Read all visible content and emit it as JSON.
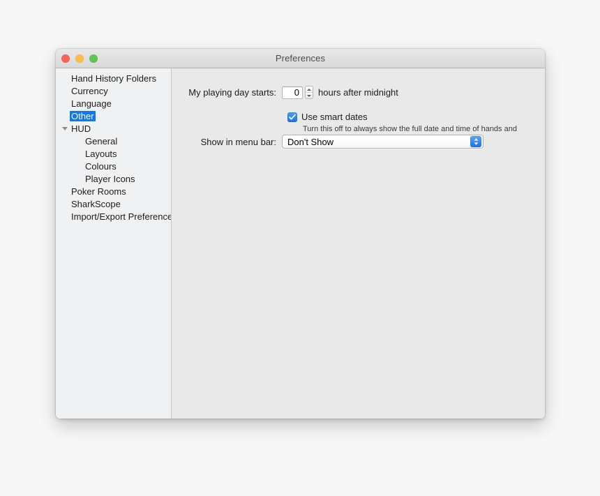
{
  "window": {
    "title": "Preferences",
    "traffic_lights": [
      {
        "name": "close",
        "color": "#f4645a"
      },
      {
        "name": "minimize",
        "color": "#f9bd4e"
      },
      {
        "name": "zoom",
        "color": "#61c555"
      }
    ]
  },
  "sidebar": {
    "selected": "Other",
    "items": [
      {
        "label": "Hand History Folders",
        "level": 0,
        "selected": false,
        "disclosure": false
      },
      {
        "label": "Currency",
        "level": 0,
        "selected": false,
        "disclosure": false
      },
      {
        "label": "Language",
        "level": 0,
        "selected": false,
        "disclosure": false
      },
      {
        "label": "Other",
        "level": 0,
        "selected": true,
        "disclosure": false
      },
      {
        "label": "HUD",
        "level": 0,
        "selected": false,
        "disclosure": true
      },
      {
        "label": "General",
        "level": 1,
        "selected": false,
        "disclosure": false
      },
      {
        "label": "Layouts",
        "level": 1,
        "selected": false,
        "disclosure": false
      },
      {
        "label": "Colours",
        "level": 1,
        "selected": false,
        "disclosure": false
      },
      {
        "label": "Player Icons",
        "level": 1,
        "selected": false,
        "disclosure": false
      },
      {
        "label": "Poker Rooms",
        "level": 0,
        "selected": false,
        "disclosure": false
      },
      {
        "label": "SharkScope",
        "level": 0,
        "selected": false,
        "disclosure": false
      },
      {
        "label": "Import/Export Preferences",
        "level": 0,
        "selected": false,
        "disclosure": false
      }
    ]
  },
  "main": {
    "playing_day": {
      "label": "My playing day starts:",
      "value": "0",
      "suffix": "hours after midnight",
      "stepper_up_icon": "chevron-up-icon",
      "stepper_down_icon": "chevron-down-icon"
    },
    "smart_dates": {
      "label": "Use smart dates",
      "checked": true,
      "hint": "Turn this off to always show the full date and time of hands and tournaments."
    },
    "menu_bar": {
      "label": "Show in menu bar:",
      "value": "Don't Show",
      "options": [
        "Don't Show"
      ],
      "arrows_icon": "up-down-chevron-icon"
    }
  },
  "colors": {
    "selection_blue": "#1277e8",
    "control_blue": "#1b73e8",
    "sidebar_bg": "#f0f1f2",
    "content_bg": "#e9e9e9",
    "page_bg": "#f7f7f7"
  }
}
